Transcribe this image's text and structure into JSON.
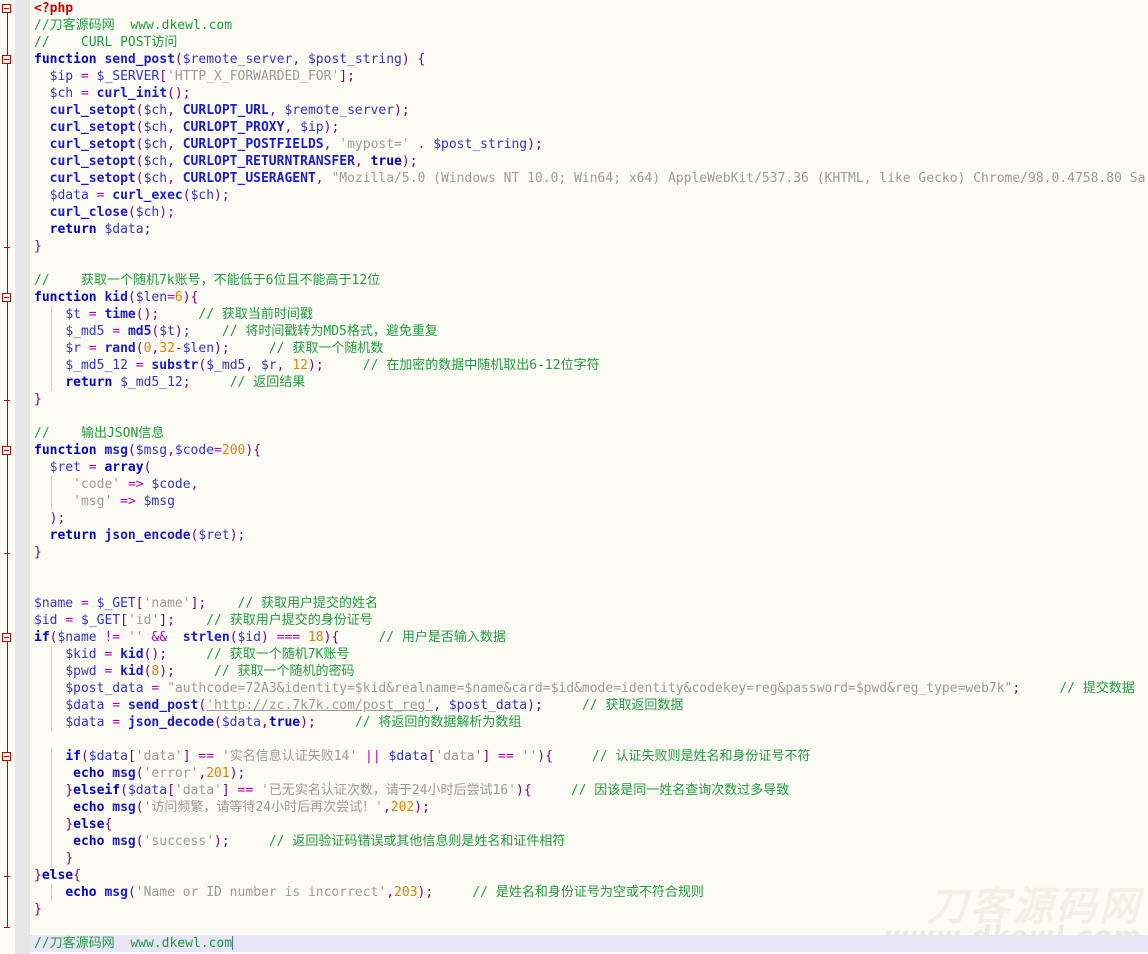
{
  "editor": {
    "language": "PHP",
    "background_color": "#fdfcf4",
    "current_line_color": "#e6e6f7",
    "gutter_color": "#e6e6e6",
    "fold_rail_color": "#c00000",
    "caret_color": "#6a5acd",
    "font_size_px": 13,
    "line_height_px": 17
  },
  "watermark": {
    "cn": "刀客源码网",
    "url": "www.dkewl.com",
    "cn_color": "#f3f0e6",
    "url_color": "#eceade"
  },
  "syntax_colors": {
    "tag": "#d00000",
    "keyword": "#0000c0",
    "function": "#1a1ad0",
    "variable": "#3333cc",
    "string": "#9a9a9a",
    "number": "#e08000",
    "operator": "#b000b0",
    "punctuation": "#800080",
    "comment": "#1f9b3f"
  },
  "code": {
    "line_count": 56,
    "lines": [
      "<?php",
      "//刀客源码网  www.dkewl.com",
      "//    CURL POST访问",
      "function send_post($remote_server, $post_string) {",
      "  $ip = $_SERVER['HTTP_X_FORWARDED_FOR'];",
      "  $ch = curl_init();",
      "  curl_setopt($ch, CURLOPT_URL, $remote_server);",
      "  curl_setopt($ch, CURLOPT_PROXY, $ip);",
      "  curl_setopt($ch, CURLOPT_POSTFIELDS, 'mypost=' . $post_string);",
      "  curl_setopt($ch, CURLOPT_RETURNTRANSFER, true);",
      "  curl_setopt($ch, CURLOPT_USERAGENT, \"Mozilla/5.0 (Windows NT 10.0; Win64; x64) AppleWebKit/537.36 (KHTML, like Gecko) Chrome/98.0.4758.80 Sa",
      "  $data = curl_exec($ch);",
      "  curl_close($ch);",
      "  return $data;",
      "}",
      "",
      "//    获取一个随机7k账号，不能低于6位且不能高于12位",
      "function kid($len=6){",
      "    $t = time();     // 获取当前时间戳",
      "    $_md5 = md5($t);    // 将时间戳转为MD5格式，避免重复",
      "    $r = rand(0,32-$len);     // 获取一个随机数",
      "    $_md5_12 = substr($_md5, $r, 12);     // 在加密的数据中随机取出6-12位字符",
      "    return $_md5_12;     // 返回结果",
      "}",
      "",
      "//    输出JSON信息",
      "function msg($msg,$code=200){",
      "  $ret = array(",
      "     'code' => $code,",
      "     'msg' => $msg",
      "  );",
      "  return json_encode($ret);",
      "}",
      "",
      "",
      "$name = $_GET['name'];    // 获取用户提交的姓名",
      "$id = $_GET['id'];    // 获取用户提交的身份证号",
      "if($name != '' &&  strlen($id) === 18){     // 用户是否输入数据",
      "    $kid = kid();     // 获取一个随机7K账号",
      "    $pwd = kid(8);     // 获取一个随机的密码",
      "    $post_data = \"authcode=72A3&identity=$kid&realname=$name&card=$id&mode=identity&codekey=reg&password=$pwd&reg_type=web7k\";     // 提交数据",
      "    $data = send_post('http://zc.7k7k.com/post_reg', $post_data);     // 获取返回数据",
      "    $data = json_decode($data,true);     // 将返回的数据解析为数组",
      "",
      "    if($data['data'] == '实名信息认证失败14' || $data['data'] == ''){     // 认证失败则是姓名和身份证号不符",
      "     echo msg('error',201);",
      "    }elseif($data['data'] == '已无实名认证次数，请于24小时后尝试16'){     // 因该是同一姓名查询次数过多导致",
      "     echo msg('访问频繁，请等待24小时后再次尝试！',202);",
      "    }else{",
      "     echo msg('success');     // 返回验证码错误或其他信息则是姓名和证件相符",
      "    }",
      "}else{",
      "    echo msg('Name or ID number is incorrect',203);     // 是姓名和身份证号为空或不符合规则",
      "}",
      "",
      "//刀客源码网  www.dkewl.com"
    ],
    "current_line_index": 55,
    "caret_text": "//刀客源码网  www.dkewl.com",
    "fold_markers": [
      {
        "line": 0,
        "type": "open"
      },
      {
        "line": 3,
        "type": "open"
      },
      {
        "line": 14,
        "type": "end"
      },
      {
        "line": 17,
        "type": "open"
      },
      {
        "line": 23,
        "type": "end"
      },
      {
        "line": 26,
        "type": "open"
      },
      {
        "line": 32,
        "type": "end"
      },
      {
        "line": 37,
        "type": "open"
      },
      {
        "line": 44,
        "type": "open"
      },
      {
        "line": 51,
        "type": "end"
      },
      {
        "line": 54,
        "type": "end"
      }
    ]
  }
}
